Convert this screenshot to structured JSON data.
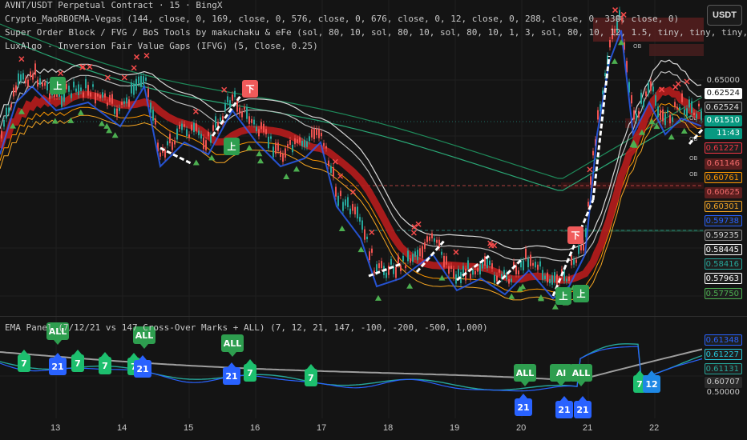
{
  "legend": {
    "line1": "AVNT/USDT Perpetual Contract · 15 · BingX",
    "line2": "Crypto_MaoRBOEMA-Vegas (144, close, 0, 169, close, 0, 576, close, 0, 676, close, 0, 12, close, 0, 288, close, 0, 338, close, 0)",
    "line3": "Super Order Block / FVG / BoS Tools by makuchaku & eFe (sol, 80, 10, sol, 80, 10, sol, 80, 10, 1, 3, sol, 80, 10, 12, 1.5, tiny, tiny, tiny,",
    "line4": "LuxAlgo - Inversion Fair Value Gaps (IFVG) (5, Close, 0.25)",
    "panel2": "EMA Panel (7/12/21 vs 147 Cross-Over Marks + ALL) (7, 12, 21, 147, -100, -200, -500, 1,000)"
  },
  "currency_button": "USDT",
  "price_labels": [
    {
      "text": "0.65000",
      "style": "plain"
    },
    {
      "text": "0.62524",
      "bg": "#ffffff",
      "fg": "#111111"
    },
    {
      "text": "0.62524",
      "bg": "#1e1e1e",
      "fg": "#e0e0e0",
      "border": "#8a8a8a"
    },
    {
      "text": "0.61510",
      "bg": "#089981",
      "fg": "#ffffff"
    },
    {
      "text": "11:43",
      "bg": "#089981",
      "fg": "#ffffff"
    },
    {
      "text": "0.61227",
      "bg": "#1e1e1e",
      "fg": "#f23645",
      "border": "#f23645"
    },
    {
      "text": "0.61146",
      "bg": "#5a1e1e",
      "fg": "#f06a6a"
    },
    {
      "text": "0.60761",
      "bg": "#1e1e1e",
      "fg": "#ff9800",
      "border": "#ff9800"
    },
    {
      "text": "0.60625",
      "bg": "#5a1e1e",
      "fg": "#f06a6a"
    },
    {
      "text": "0.60301",
      "bg": "#1e1e1e",
      "fg": "#f5a623",
      "border": "#f5a623"
    },
    {
      "text": "0.59738",
      "bg": "#1e1e1e",
      "fg": "#2962ff",
      "border": "#2962ff"
    },
    {
      "text": "0.59235",
      "bg": "#1e1e1e",
      "fg": "#d0d0d0",
      "border": "#8a8a8a"
    },
    {
      "text": "0.58445",
      "bg": "#1e1e1e",
      "fg": "#ffffff",
      "border": "#ffffff"
    },
    {
      "text": "0.58416",
      "bg": "#1e1e1e",
      "fg": "#26a69a",
      "border": "#26a69a"
    },
    {
      "text": "0.57963",
      "bg": "#1e1e1e",
      "fg": "#ffffff",
      "border": "#ffffff"
    },
    {
      "text": "0.57750",
      "bg": "#1e1e1e",
      "fg": "#4caf50",
      "border": "#4caf50"
    }
  ],
  "panel_labels": [
    {
      "text": "0.61348",
      "bg": "#1e1e1e",
      "fg": "#2962ff",
      "border": "#2962ff"
    },
    {
      "text": "0.61227",
      "bg": "#1e1e1e",
      "fg": "#26c6da",
      "border": "#26c6da"
    },
    {
      "text": "0.61131",
      "bg": "#1e1e1e",
      "fg": "#26a69a",
      "border": "#26a69a"
    },
    {
      "text": "0.60707",
      "bg": "#2a2a2a",
      "fg": "#c7c7c7"
    },
    {
      "text": "0.50000",
      "style": "plain"
    }
  ],
  "time_ticks": [
    "13",
    "14",
    "15",
    "16",
    "17",
    "18",
    "19",
    "20",
    "21",
    "22"
  ],
  "markers": {
    "up_char": "上",
    "down_char": "下",
    "all": "ALL",
    "all_partial": "Al",
    "n7": "7",
    "n12": "12",
    "n21": "21"
  },
  "ob_tag": "OB",
  "colors": {
    "up": "#26a69a",
    "down": "#ef5350",
    "ema_red": "#b71c1c",
    "blue": "#2962ff",
    "white_line": "#ffffff",
    "signal_green": "#4caf50",
    "signal_red": "#f44b4b"
  }
}
